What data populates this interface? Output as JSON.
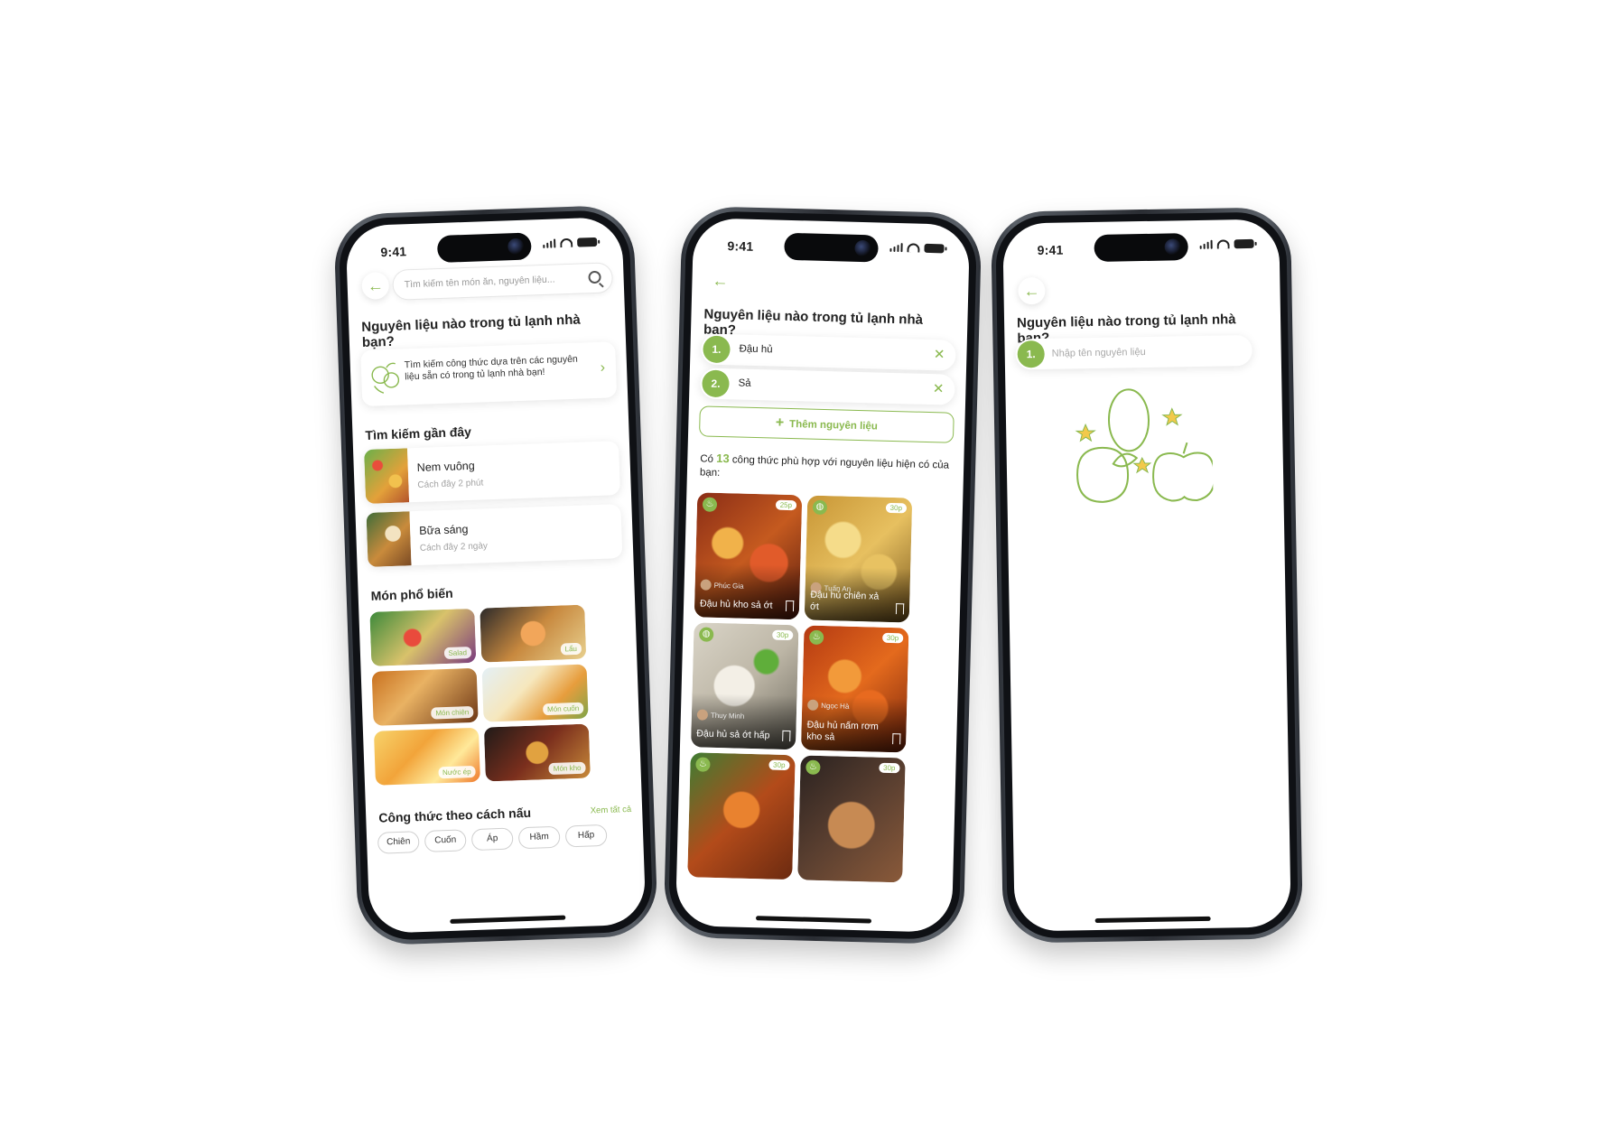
{
  "colors": {
    "accent": "#8ab94f",
    "text": "#1f1f1f",
    "muted": "#a3a3a3"
  },
  "status": {
    "time": "9:41"
  },
  "screen1": {
    "search_placeholder": "Tìm kiếm tên món ăn, nguyên liệu...",
    "heading": "Nguyên liệu nào trong tủ lạnh nhà bạn?",
    "promo_text": "Tìm kiếm công thức dựa trên các nguyên liệu sẵn có trong tủ lạnh nhà bạn!",
    "recent_title": "Tìm kiếm gần đây",
    "recent": [
      {
        "name": "Nem vuông",
        "meta": "Cách đây 2 phút"
      },
      {
        "name": "Bữa sáng",
        "meta": "Cách đây 2 ngày"
      }
    ],
    "popular_title": "Món phổ biến",
    "popular": [
      "Salad",
      "Lẩu",
      "Món chiên",
      "Món cuốn",
      "Nước ép",
      "Món kho"
    ],
    "cook_title": "Công thức theo cách nấu",
    "see_all": "Xem tất cả",
    "chips": [
      "Chiên",
      "Cuốn",
      "Áp",
      "Hầm",
      "Hấp"
    ]
  },
  "screen2": {
    "heading": "Nguyên liệu nào trong tủ lạnh nhà bạn?",
    "ingredients": [
      {
        "num": "1.",
        "name": "Đậu hủ"
      },
      {
        "num": "2.",
        "name": "Sả"
      }
    ],
    "add_label": "Thêm nguyên liệu",
    "result_prefix": "Có",
    "result_count": "13",
    "result_suffix": "công thức phù hợp với nguyên liệu hiện có của bạn:",
    "recipes": [
      {
        "author": "Phúc Gia",
        "name": "Đậu hủ kho sả ớt",
        "time": "25p"
      },
      {
        "author": "Tuấn An",
        "name": "Đậu hủ chiên xả ớt",
        "time": "30p"
      },
      {
        "author": "Thuy Minh",
        "name": "Đậu hủ sả ớt hấp",
        "time": "30p"
      },
      {
        "author": "Ngọc Hà",
        "name": "Đậu hủ nấm rơm kho sả",
        "time": "30p"
      },
      {
        "author": "",
        "name": "",
        "time": "30p"
      },
      {
        "author": "",
        "name": "",
        "time": "30p"
      }
    ]
  },
  "screen3": {
    "heading": "Nguyên liệu nào trong tủ lạnh nhà bạn?",
    "input_num": "1.",
    "input_placeholder": "Nhập tên nguyên liệu"
  }
}
